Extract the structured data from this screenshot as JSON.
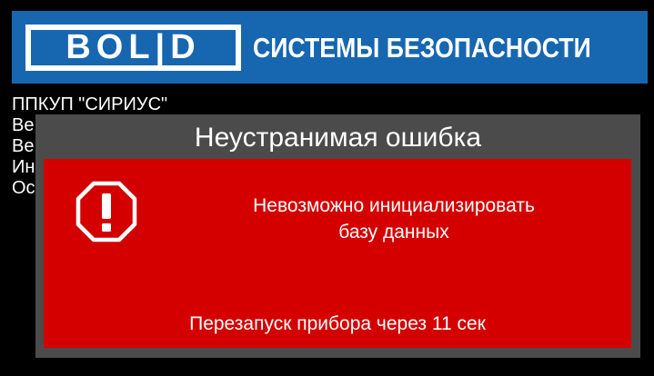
{
  "header": {
    "logo_text": "BOL|D",
    "title": "СИСТЕМЫ БЕЗОПАСНОСТИ",
    "background_color": "#1766b0"
  },
  "device_info": {
    "lines": [
      "ППКУП \"СИРИУС\"",
      "Ве",
      "Ве",
      "Ин",
      "Ос"
    ]
  },
  "dialog": {
    "title": "Неустранимая ошибка",
    "icon": "stop-octagon-exclamation-icon",
    "message_line1": "Невозможно инициализировать",
    "message_line2": "базу данных",
    "restart_text": "Перезапуск прибора через 11 сек",
    "frame_color": "#4b4b4b",
    "body_color": "#d40000"
  }
}
